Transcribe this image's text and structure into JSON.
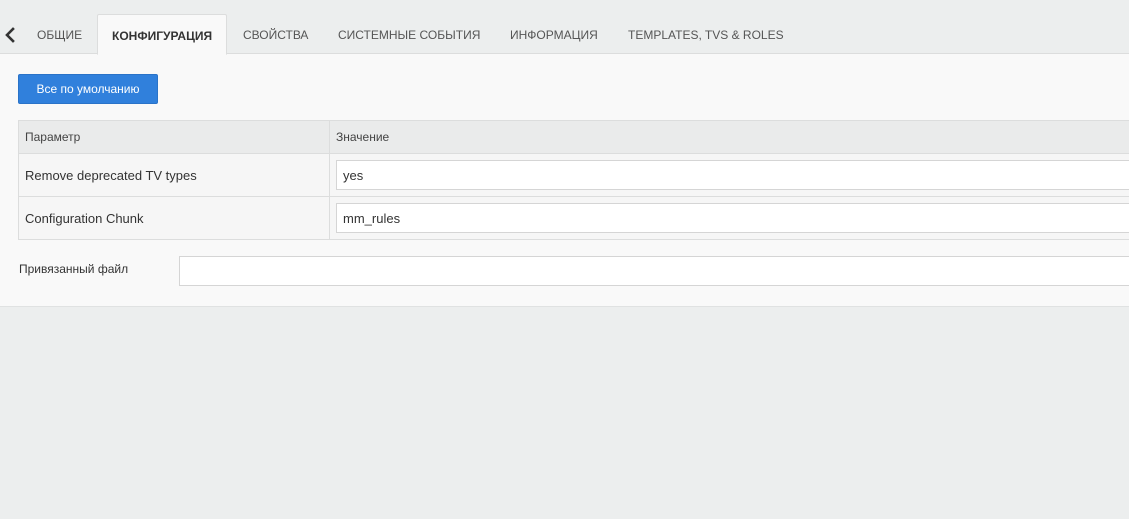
{
  "tabs": [
    {
      "label": "Общие"
    },
    {
      "label": "Конфигурация",
      "active": true
    },
    {
      "label": "Свойства"
    },
    {
      "label": "Системные события"
    },
    {
      "label": "Информация"
    },
    {
      "label": "Templates, TVs & Roles"
    }
  ],
  "icons": {
    "back": "chevron-left-icon"
  },
  "toolbar": {
    "defaults_label": "Все по умолчанию"
  },
  "table": {
    "headers": [
      "Параметр",
      "Значение"
    ],
    "rows": [
      {
        "param": "Remove deprecated TV types",
        "value": "yes"
      },
      {
        "param": "Configuration Chunk",
        "value": "mm_rules"
      }
    ]
  },
  "linked_file": {
    "label": "Привязанный файл",
    "value": ""
  },
  "colors": {
    "accent": "#3080dc",
    "background": "#eceeee",
    "panel": "#f9f9f9"
  }
}
